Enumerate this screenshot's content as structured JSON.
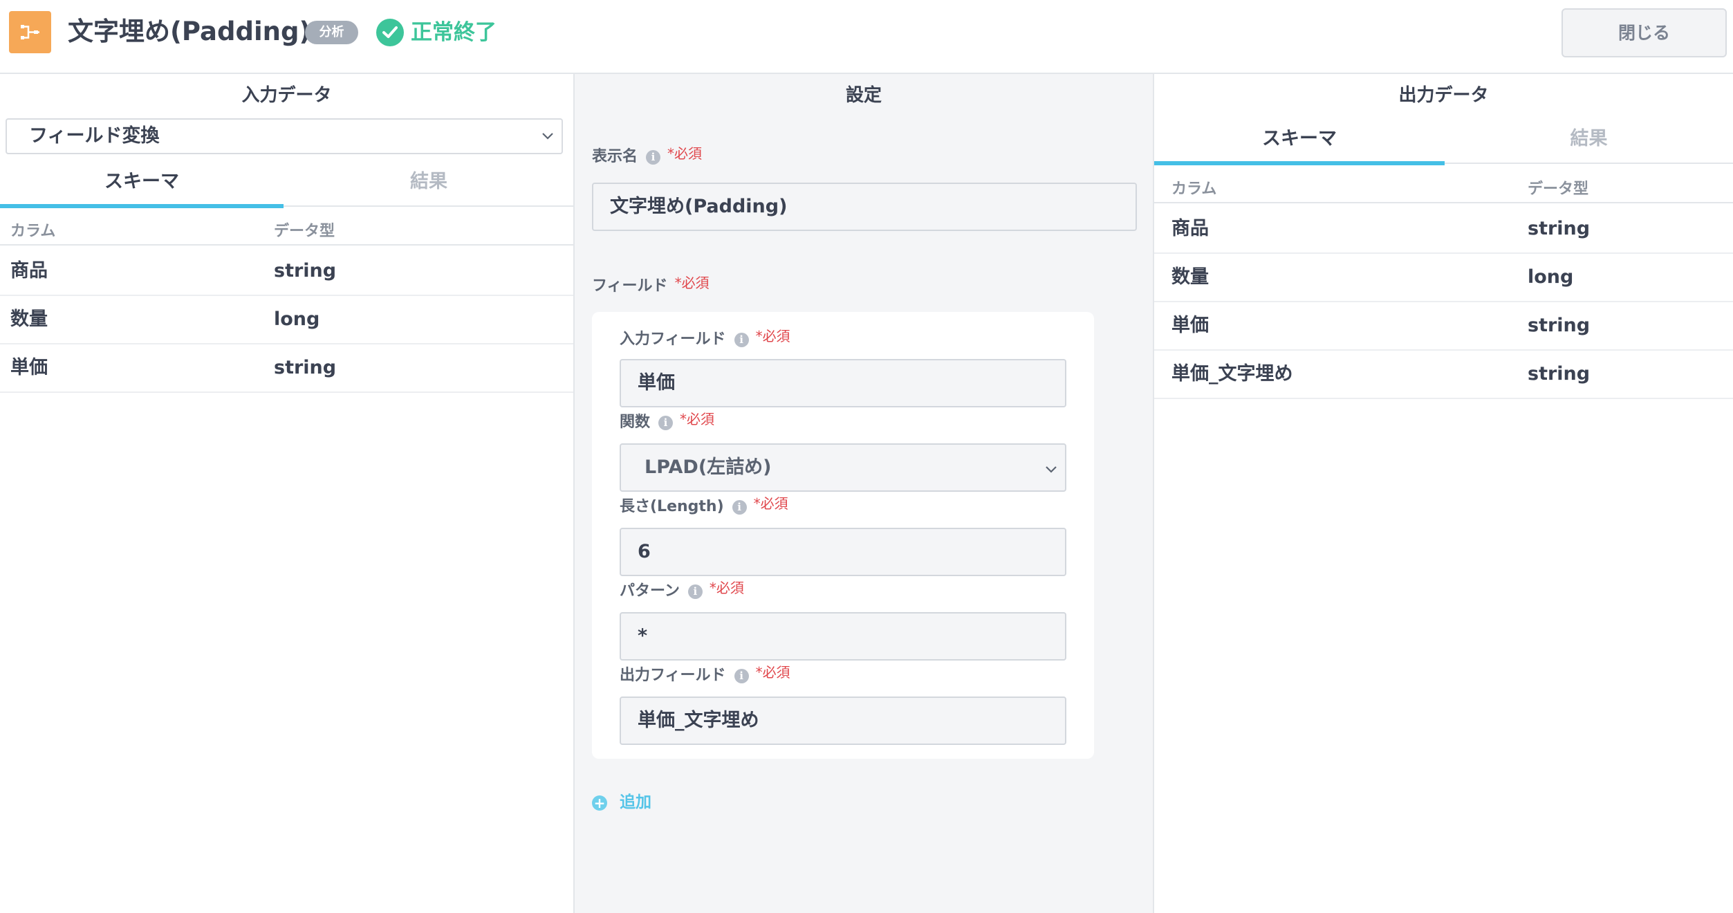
{
  "header": {
    "title": "文字埋め(Padding)",
    "badge": "分析",
    "status": "正常終了",
    "close_label": "閉じる",
    "node_icon": "transform-node-icon",
    "status_icon": "check-circle-icon"
  },
  "input_panel": {
    "title": "入力データ",
    "source_select": "フィールド変換",
    "tabs": [
      "スキーマ",
      "結果"
    ],
    "active_tab": "スキーマ",
    "columns": [
      "カラム",
      "データ型"
    ],
    "rows": [
      {
        "column": "商品",
        "type": "string"
      },
      {
        "column": "数量",
        "type": "long"
      },
      {
        "column": "単価",
        "type": "string"
      }
    ]
  },
  "settings_panel": {
    "title": "設定",
    "display_name_label": "表示名",
    "display_name_value": "文字埋め(Padding)",
    "fields_label": "フィールド",
    "required_mark": "*必須",
    "input_field_label": "入力フィールド",
    "input_field_value": "単価",
    "function_label": "関数",
    "function_value": "LPAD(左詰め)",
    "length_label": "長さ(Length)",
    "length_value": "6",
    "pattern_label": "パターン",
    "pattern_value": "*",
    "output_field_label": "出力フィールド",
    "output_field_value": "単価_文字埋め",
    "add_label": "追加"
  },
  "output_panel": {
    "title": "出力データ",
    "tabs": [
      "スキーマ",
      "結果"
    ],
    "active_tab": "スキーマ",
    "columns": [
      "カラム",
      "データ型"
    ],
    "rows": [
      {
        "column": "商品",
        "type": "string"
      },
      {
        "column": "数量",
        "type": "long"
      },
      {
        "column": "単価",
        "type": "string"
      },
      {
        "column": "単価_文字埋め",
        "type": "string"
      }
    ]
  },
  "colors": {
    "accent": "#44bfe6",
    "success": "#3dc59a",
    "node": "#f6a857",
    "required": "#e0474c"
  }
}
